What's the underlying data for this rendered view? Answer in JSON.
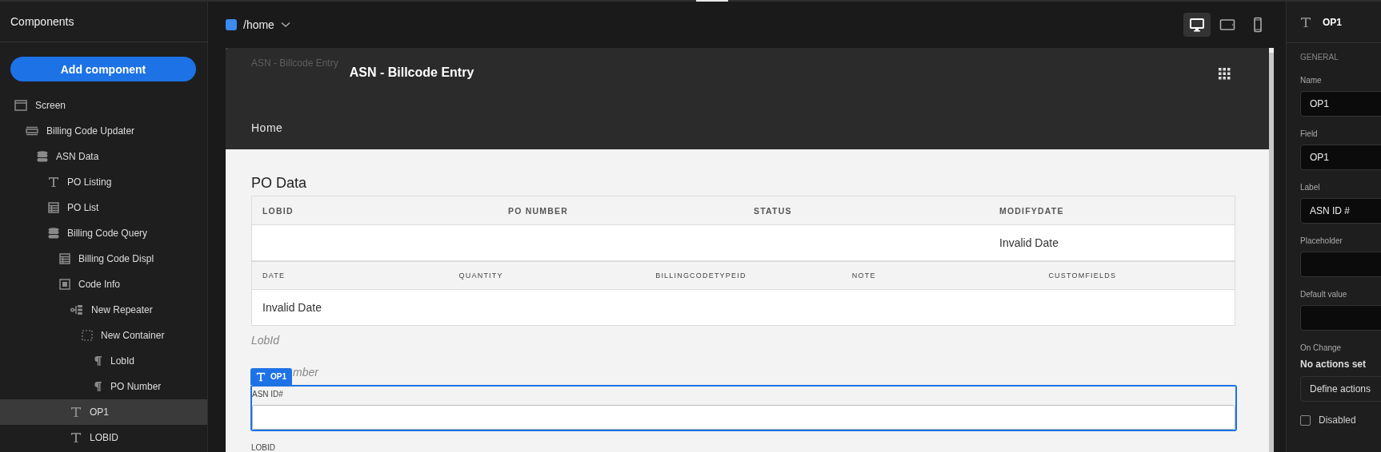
{
  "sidebar": {
    "title": "Components",
    "add_button": "Add component",
    "tree": [
      {
        "label": "Screen",
        "kind": "screen",
        "selected": false,
        "children": [
          {
            "label": "Billing Code Updater",
            "kind": "list",
            "selected": false,
            "children": [
              {
                "label": "ASN Data",
                "kind": "database",
                "selected": false,
                "children": [
                  {
                    "label": "PO Listing",
                    "kind": "text",
                    "selected": false
                  },
                  {
                    "label": "PO List",
                    "kind": "table",
                    "selected": false
                  },
                  {
                    "label": "Billing Code Query",
                    "kind": "database",
                    "selected": false,
                    "children": [
                      {
                        "label": "Billing Code Displ",
                        "kind": "table",
                        "selected": false
                      },
                      {
                        "label": "Code Info",
                        "kind": "group",
                        "selected": false,
                        "children": [
                          {
                            "label": "New Repeater",
                            "kind": "repeater",
                            "selected": false,
                            "children": [
                              {
                                "label": "New Container",
                                "kind": "container",
                                "selected": false,
                                "children": [
                                  {
                                    "label": "LobId",
                                    "kind": "paragraph",
                                    "selected": false
                                  },
                                  {
                                    "label": "PO Number",
                                    "kind": "paragraph",
                                    "selected": false
                                  }
                                ]
                              }
                            ]
                          },
                          {
                            "label": "OP1",
                            "kind": "text",
                            "selected": true
                          },
                          {
                            "label": "LOBID",
                            "kind": "text",
                            "selected": false
                          }
                        ]
                      }
                    ]
                  }
                ]
              }
            ]
          }
        ]
      }
    ]
  },
  "canvas": {
    "route": "/home",
    "devices": [
      {
        "kind": "desktop",
        "selected": true
      },
      {
        "kind": "tablet",
        "selected": false
      },
      {
        "kind": "phone",
        "selected": false
      }
    ],
    "app": {
      "brand": "ASN - Billcode Entry",
      "title": "ASN - Billcode Entry",
      "nav": [
        "Home"
      ],
      "heading": "PO Data",
      "tables": [
        {
          "columns": [
            "LOBID",
            "PO NUMBER",
            "STATUS",
            "MODIFYDATE"
          ],
          "rows": [
            [
              null,
              null,
              null,
              "Invalid Date"
            ]
          ]
        },
        {
          "columns": [
            "DATE",
            "QUANTITY",
            "BILLINGCODETYPEID",
            "NOTE",
            "CUSTOMFIELDS"
          ],
          "rows": [
            [
              "Invalid Date",
              null,
              null,
              null,
              null
            ]
          ]
        }
      ],
      "texts": [
        "LobId",
        "mber"
      ],
      "selected_component": {
        "badge": "OP1",
        "label": "ASN ID#"
      },
      "next_label": "LOBID"
    }
  },
  "inspector": {
    "title": "OP1",
    "section": "GENERAL",
    "fields": [
      {
        "label": "Name",
        "value": "OP1"
      },
      {
        "label": "Field",
        "value": "OP1"
      },
      {
        "label": "Label",
        "value": "ASN ID #"
      },
      {
        "label": "Placeholder"
      },
      {
        "label": "Default value"
      }
    ],
    "on_change": {
      "label": "On Change",
      "status": "No actions set",
      "button": "Define actions"
    },
    "disabled": {
      "label": "Disabled",
      "checked": false
    }
  }
}
